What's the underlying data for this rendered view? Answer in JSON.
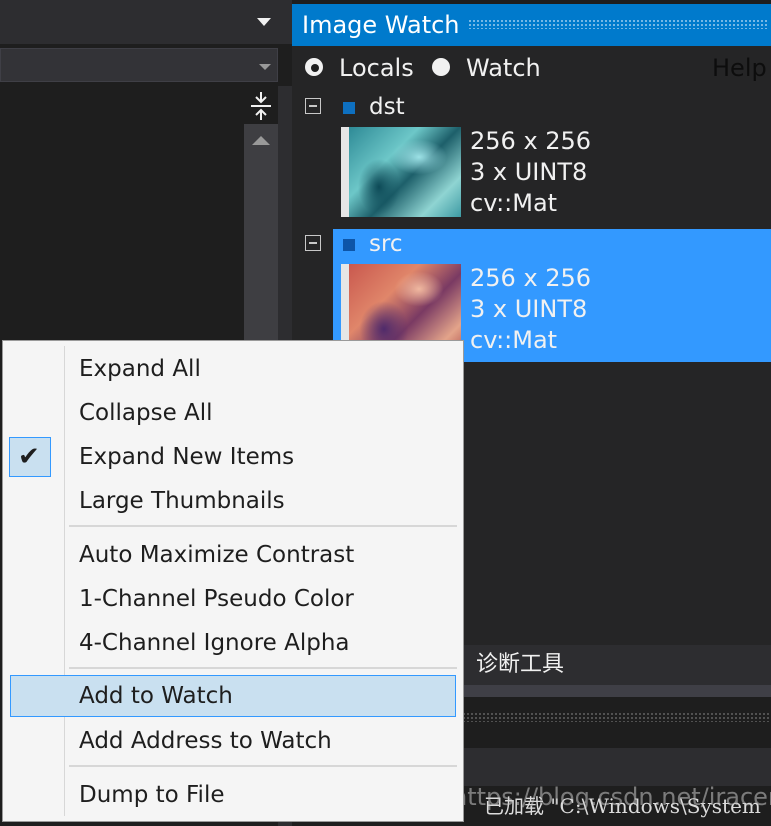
{
  "image_watch": {
    "title": "Image Watch",
    "toolbar": {
      "locals_label": "Locals",
      "watch_label": "Watch",
      "help_label": "Help",
      "selected_mode": "Locals"
    },
    "items": [
      {
        "name": "dst",
        "size": "256 x 256",
        "format": "3 x UINT8",
        "type": "cv::Mat",
        "selected": false
      },
      {
        "name": "src",
        "size": "256 x 256",
        "format": "3 x UINT8",
        "type": "cv::Mat",
        "selected": true
      }
    ]
  },
  "context_menu": {
    "items": [
      {
        "label": "Expand All"
      },
      {
        "label": "Collapse All"
      },
      {
        "label": "Expand New Items",
        "checked": true
      },
      {
        "label": "Large Thumbnails"
      },
      {
        "label": "Auto Maximize Contrast"
      },
      {
        "label": "1-Channel Pseudo Color"
      },
      {
        "label": "4-Channel Ignore Alpha"
      },
      {
        "label": "Add to Watch",
        "highlighted": true
      },
      {
        "label": "Add Address to Watch"
      },
      {
        "label": "Dump to File"
      }
    ]
  },
  "bottom": {
    "tab_label": "诊断工具",
    "output_text": "已加载 \"C:\\Windows\\System",
    "watermark": "https://blog.csdn.net/iracer"
  },
  "colors": {
    "accent": "#007acc",
    "selection": "#3399ff",
    "menu_highlight": "#c9e0f0"
  },
  "icons": {
    "split": "split-vertical-icon",
    "check": "checkmark-icon",
    "collapse": "minus-box-icon"
  }
}
